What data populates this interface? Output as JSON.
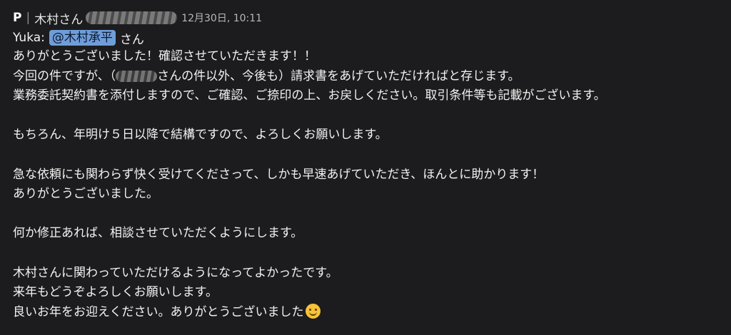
{
  "message": {
    "channel_label": "P",
    "separator": "|",
    "sender_prefix": "木村さん",
    "timestamp": "12月30日, 10:11",
    "reply_author": "Yuka:",
    "mention": "@木村承平",
    "mention_suffix": "さん",
    "lines": [
      "ありがとうございました！確認させていただきます！！",
      "今回の件ですが、（",
      "さんの件以外、今後も）請求書をあげていただければと存じます。",
      "業務委託契約書を添付しますので、ご確認、ご捺印の上、お戻しください。取引条件等も記載がございます。",
      "",
      "もちろん、年明け５日以降で結構ですので、よろしくお願いします。",
      "",
      "急な依頼にも関わらず快く受けてくださって、しかも早速あげていただき、ほんとに助かります！",
      "ありがとうございました。",
      "",
      "何か修正あれば、相談させていただくようにします。",
      "",
      "木村さんに関わっていただけるようになってよかったです。",
      "来年もどうぞよろしくお願いします。",
      "良いお年をお迎えください。ありがとうございました"
    ],
    "emoji_icon": "smiling-face-emoji"
  }
}
